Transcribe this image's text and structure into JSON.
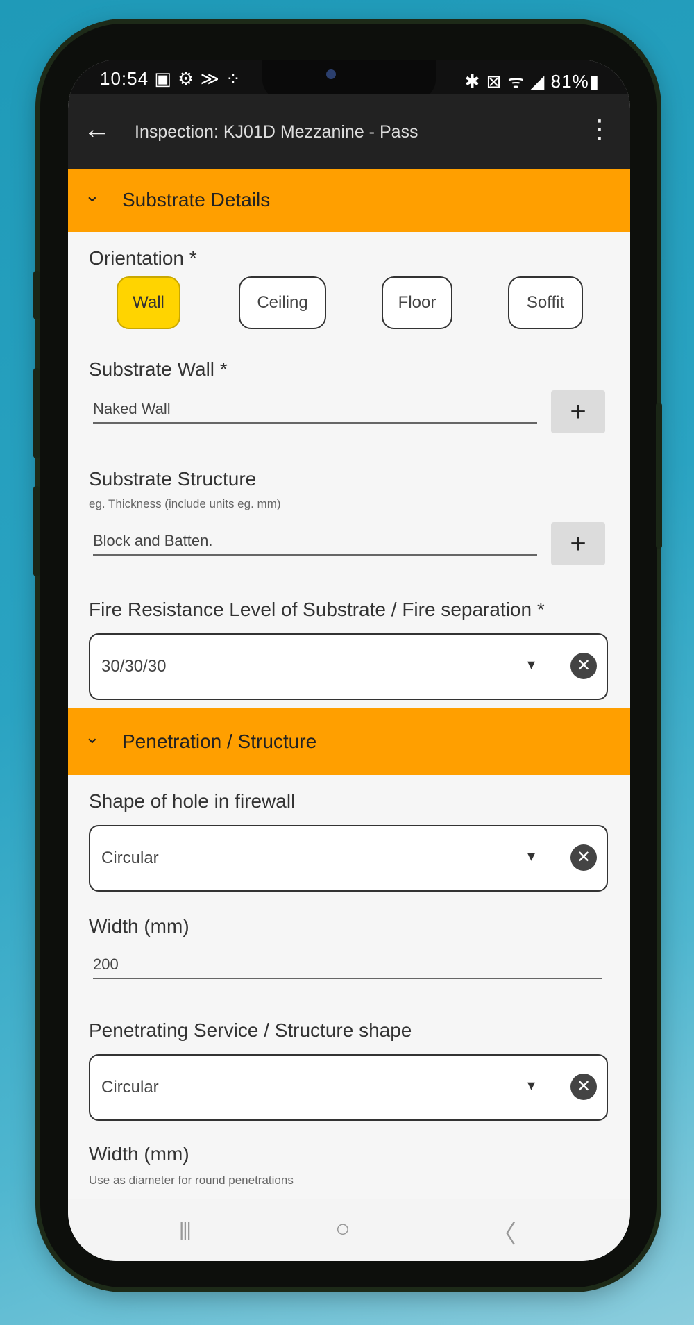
{
  "status_bar": {
    "time_and_icons": "10:54 ▣ ⚙ ≫ ⁘",
    "right_icons": "✱ ⊠ ᯤ ◢ 81%▮"
  },
  "app_bar": {
    "back_icon": "←",
    "title": "Inspection: KJ01D Mezzanine - Pass",
    "more_icon": "⋮"
  },
  "section_substrate": {
    "chevron": "⌄",
    "title": "Substrate Details"
  },
  "orientation": {
    "label": "Orientation *",
    "options": [
      "Wall",
      "Ceiling",
      "Floor",
      "Soffit"
    ],
    "selected": "Wall"
  },
  "substrate_wall": {
    "label": "Substrate Wall *",
    "value": "Naked Wall",
    "add_icon": "+"
  },
  "substrate_structure": {
    "label": "Substrate Structure",
    "hint": "eg. Thickness (include units eg. mm)",
    "value": "Block and Batten.",
    "add_icon": "+"
  },
  "fire_resistance": {
    "label": "Fire Resistance Level of Substrate / Fire separation *",
    "value": "30/30/30",
    "caret": "▾",
    "clear_icon": "✕"
  },
  "section_penetration": {
    "chevron": "⌄",
    "title": "Penetration / Structure"
  },
  "hole_shape": {
    "label": "Shape of hole in firewall",
    "value": "Circular",
    "caret": "▾",
    "clear_icon": "✕"
  },
  "hole_width": {
    "label": "Width (mm)",
    "value": "200"
  },
  "service_shape": {
    "label": "Penetrating Service / Structure shape",
    "value": "Circular",
    "caret": "▾",
    "clear_icon": "✕"
  },
  "service_width": {
    "label": "Width (mm)",
    "hint": "Use as diameter for round penetrations"
  },
  "nav_bar": {
    "recents_icon": "|||",
    "home_icon": "○",
    "back_icon": "〈"
  }
}
